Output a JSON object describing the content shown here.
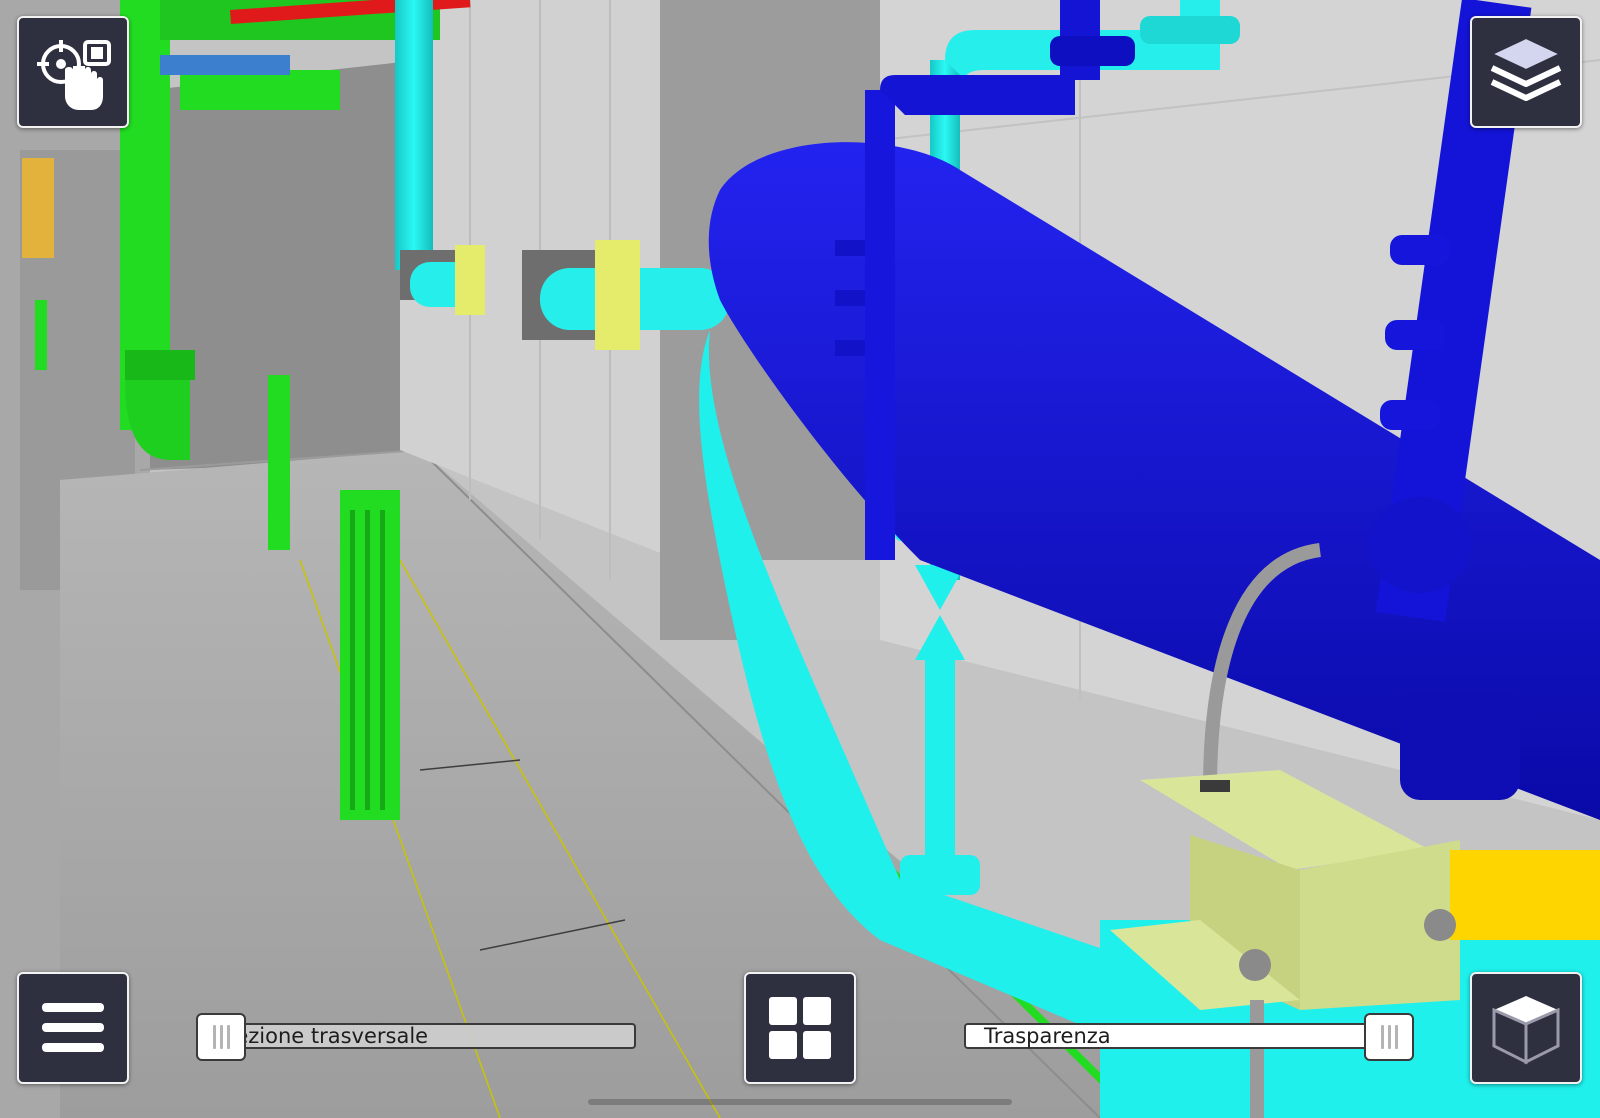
{
  "viewport": {
    "scene_description": "3D BIM model view of a technical room with pipes",
    "colors": {
      "cyan_pipe": "#1ef2ee",
      "blue_pipe": "#1212d8",
      "green_pipe": "#22dc22",
      "support_bracket": "#d9e69a",
      "wall": "#cfcfcf",
      "floor": "#a9a9a9",
      "button_bg": "#2e3040"
    }
  },
  "toolbar": {
    "select_tool_icon": "target-hand-icon",
    "layers_icon": "layers-icon",
    "menu_icon": "hamburger-menu-icon",
    "grid_icon": "grid-view-icon",
    "view_cube_icon": "cube-icon"
  },
  "sliders": {
    "section": {
      "label": "Sezione trasversale",
      "value": 0.0
    },
    "transparency": {
      "label": "Trasparenza",
      "value": 1.0
    }
  }
}
